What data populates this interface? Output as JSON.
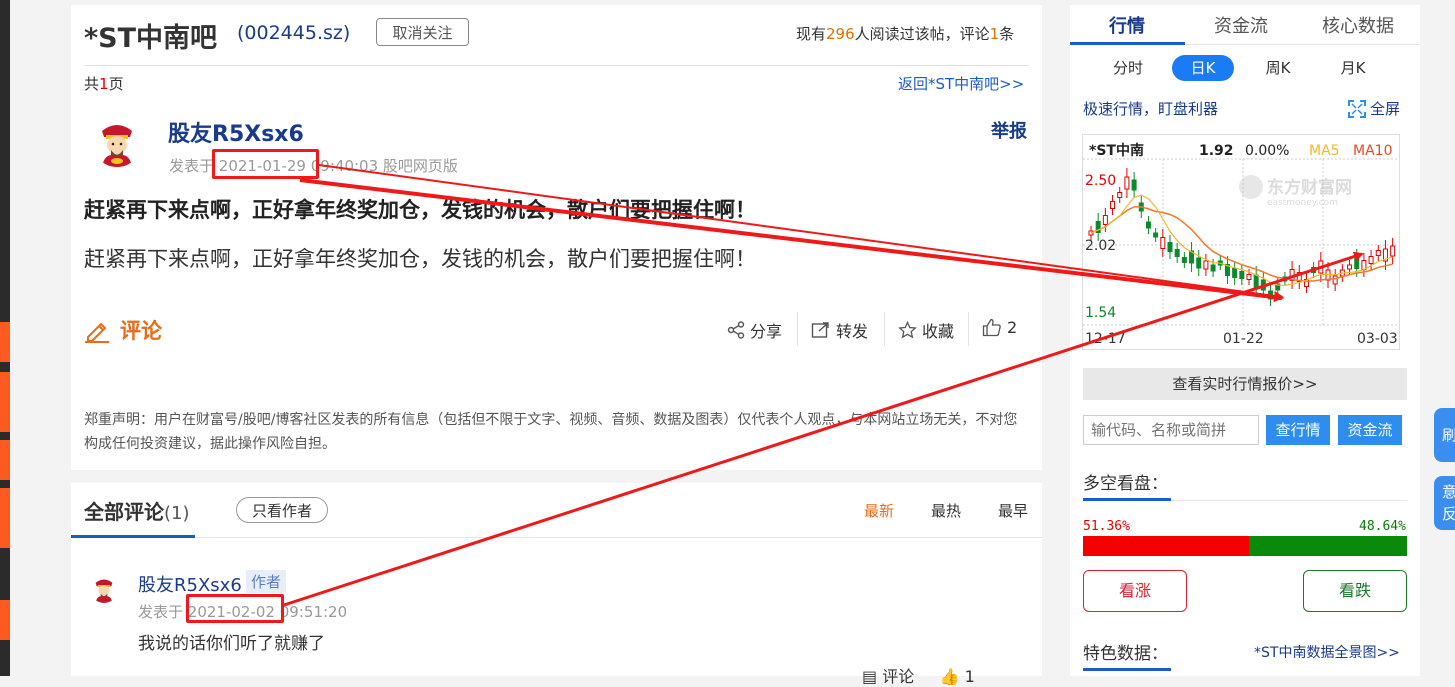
{
  "post": {
    "stock_title": "*ST中南吧",
    "stock_code": "(002445.sz)",
    "unfollow_label": "取消关注",
    "read_prefix": "现有",
    "read_count": "296",
    "read_middle": "人阅读过该帖，评论",
    "comment_count": "1",
    "read_suffix": "条",
    "page_prefix": "共",
    "page_num": "1",
    "page_suffix": "页",
    "back_link": "返回*ST中南吧>>",
    "author": "股友R5Xsx6",
    "report_label": "举报",
    "meta_prefix": "发表于",
    "date": "2021-01-29",
    "time": "09:40:03",
    "source": "股吧网页版",
    "title": "赶紧再下来点啊，正好拿年终奖加仓，发钱的机会，散户们要把握住啊！",
    "body": "赶紧再下来点啊，正好拿年终奖加仓，发钱的机会，散户们要把握住啊！",
    "comment_label": "评论",
    "share_label": "分享",
    "forward_label": "转发",
    "favorite_label": "收藏",
    "like_count": "2",
    "disclaimer": "郑重声明：用户在财富号/股吧/博客社区发表的所有信息（包括但不限于文字、视频、音频、数据及图表）仅代表个人观点，与本网站立场无关，不对您构成任何投资建议，据此操作风险自担。"
  },
  "comments": {
    "tab_label": "全部评论",
    "tab_count": "(1)",
    "only_author_label": "只看作者",
    "sort_newest": "最新",
    "sort_hottest": "最热",
    "sort_earliest": "最早",
    "item": {
      "author": "股友R5Xsx6",
      "badge": "作者",
      "meta_prefix": "发表于",
      "date": "2021-02-02",
      "time": "09:51:20",
      "text": "我说的话你们听了就赚了",
      "comment_action": "评论",
      "like_count": "1"
    }
  },
  "sidebar": {
    "tabs": [
      "行情",
      "资金流",
      "核心数据"
    ],
    "periods": [
      "分时",
      "日K",
      "周K",
      "月K"
    ],
    "speed_text": "极速行情，盯盘利器",
    "fullscreen_label": "全屏",
    "realtime_btn": "查看实时行情报价>>",
    "code_placeholder": "输代码、名称或简拼",
    "quote_btn": "查行情",
    "fund_btn": "资金流",
    "bullbear_title": "多空看盘：",
    "bull_pct": "51.36%",
    "bear_pct": "48.64%",
    "bull_ratio": 0.5136,
    "bull_btn": "看涨",
    "bear_btn": "看跌",
    "feature_title": "特色数据：",
    "feature_link": "*ST中南数据全景图>>"
  },
  "chart": {
    "name": "*ST中南",
    "price": "1.92",
    "change": "0.00%",
    "ma5_label": "MA5",
    "ma10_label": "MA10",
    "y_high": "2.50",
    "y_mid": "2.02",
    "y_low": "1.54",
    "x_labels": [
      "12-17",
      "01-22",
      "03-03"
    ],
    "watermark": "东方财富网",
    "watermark_sub": "eastmoney.com",
    "colors": {
      "up": "#e30000",
      "down": "#0a8a2a",
      "ma5": "#f5b72c",
      "ma10": "#f07a2a"
    }
  },
  "float_buttons": [
    "刷",
    "意反"
  ],
  "colors": {
    "accent_blue": "#1a5cc9",
    "orange": "#e86b1a",
    "annotation_red": "#f01818"
  }
}
